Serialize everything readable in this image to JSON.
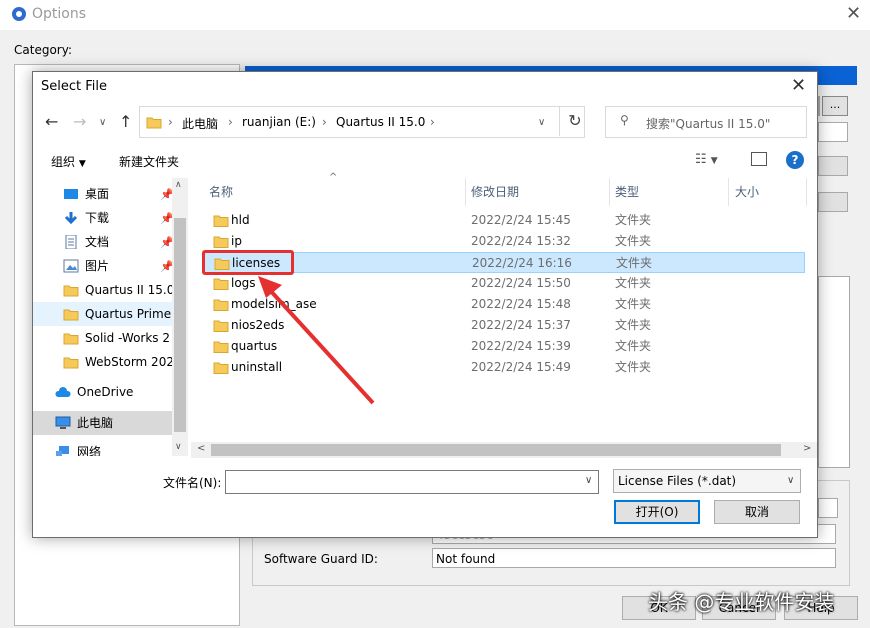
{
  "options_window": {
    "title": "Options",
    "category_label": "Category:",
    "browse_label": "...",
    "software_guard_label": "Software Guard ID:",
    "software_guard_value": "Not found",
    "obscured_value": "43cc5c5c",
    "buttons": {
      "ok": "OK",
      "cancel": "Cancel",
      "help": "Help"
    }
  },
  "dialog": {
    "title": "Select File",
    "breadcrumb": [
      "此电脑",
      "ruanjian (E:)",
      "Quartus II 15.0"
    ],
    "search_placeholder": "搜索\"Quartus II 15.0\"",
    "organize_label": "组织",
    "new_folder_label": "新建文件夹",
    "nav_items": [
      {
        "label": "桌面",
        "icon": "desktop-icon",
        "pinned": true
      },
      {
        "label": "下载",
        "icon": "download-icon",
        "pinned": true
      },
      {
        "label": "文档",
        "icon": "document-icon",
        "pinned": true
      },
      {
        "label": "图片",
        "icon": "picture-icon",
        "pinned": true
      },
      {
        "label": "Quartus II 15.0",
        "icon": "folder-icon",
        "pinned": false
      },
      {
        "label": "Quartus Prime",
        "icon": "folder-icon",
        "pinned": false
      },
      {
        "label": "Solid -Works 2",
        "icon": "folder-icon",
        "pinned": false
      },
      {
        "label": "WebStorm 202",
        "icon": "folder-icon",
        "pinned": false
      },
      {
        "label": "OneDrive",
        "icon": "cloud-icon",
        "pinned": false
      },
      {
        "label": "此电脑",
        "icon": "computer-icon",
        "pinned": false
      },
      {
        "label": "网络",
        "icon": "network-icon",
        "pinned": false
      }
    ],
    "columns": {
      "name": "名称",
      "date": "修改日期",
      "type": "类型",
      "size": "大小"
    },
    "files": [
      {
        "name": "hld",
        "date": "2022/2/24 15:45",
        "type": "文件夹"
      },
      {
        "name": "ip",
        "date": "2022/2/24 15:32",
        "type": "文件夹"
      },
      {
        "name": "licenses",
        "date": "2022/2/24 16:16",
        "type": "文件夹"
      },
      {
        "name": "logs",
        "date": "2022/2/24 15:50",
        "type": "文件夹"
      },
      {
        "name": "modelsim_ase",
        "date": "2022/2/24 15:48",
        "type": "文件夹"
      },
      {
        "name": "nios2eds",
        "date": "2022/2/24 15:37",
        "type": "文件夹"
      },
      {
        "name": "quartus",
        "date": "2022/2/24 15:39",
        "type": "文件夹"
      },
      {
        "name": "uninstall",
        "date": "2022/2/24 15:49",
        "type": "文件夹"
      }
    ],
    "filename_label": "文件名(N):",
    "filename_value": "",
    "filter_value": "License Files (*.dat)",
    "open_label": "打开(O)",
    "cancel_label": "取消"
  },
  "watermark": "头条 @专业软件安装",
  "colors": {
    "accent": "#0078d7",
    "selection": "#cce8ff",
    "annotation": "#e53030"
  }
}
